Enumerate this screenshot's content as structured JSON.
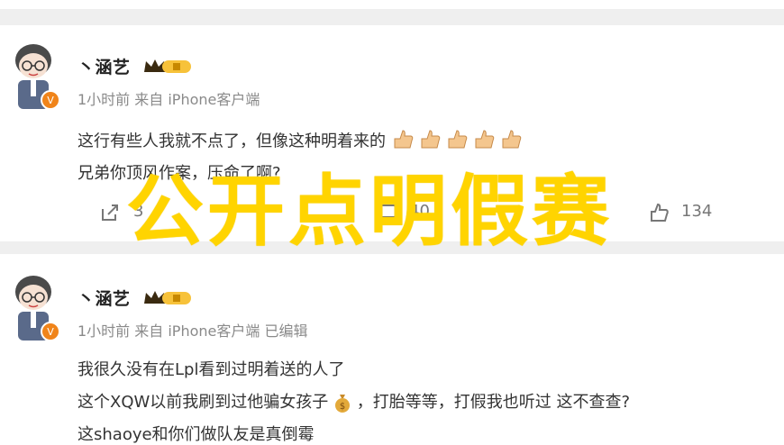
{
  "posts": [
    {
      "username": "丶涵艺",
      "meta": "1小时前 来自 iPhone客户端",
      "lines": [
        "这行有些人我就不点了，但像这种明着来的",
        "兄弟你顶风作案，压命了啊?"
      ],
      "share_count": "3",
      "comment_count": "40",
      "like_count": "134"
    },
    {
      "username": "丶涵艺",
      "meta": "1小时前 来自 iPhone客户端 已编辑",
      "lines": [
        "我很久没有在Lpl看到过明着送的人了",
        "这个XQW以前我刷到过他骗女孩子",
        "，打胎等等，打假我也听过 这不查查?",
        "这shaoye和你们做队友是真倒霉"
      ]
    }
  ],
  "overlay_caption": "公开点明假赛",
  "colors": {
    "caption": "#ffd400",
    "meta": "#8a8a8a",
    "verified": "#f0841a"
  }
}
